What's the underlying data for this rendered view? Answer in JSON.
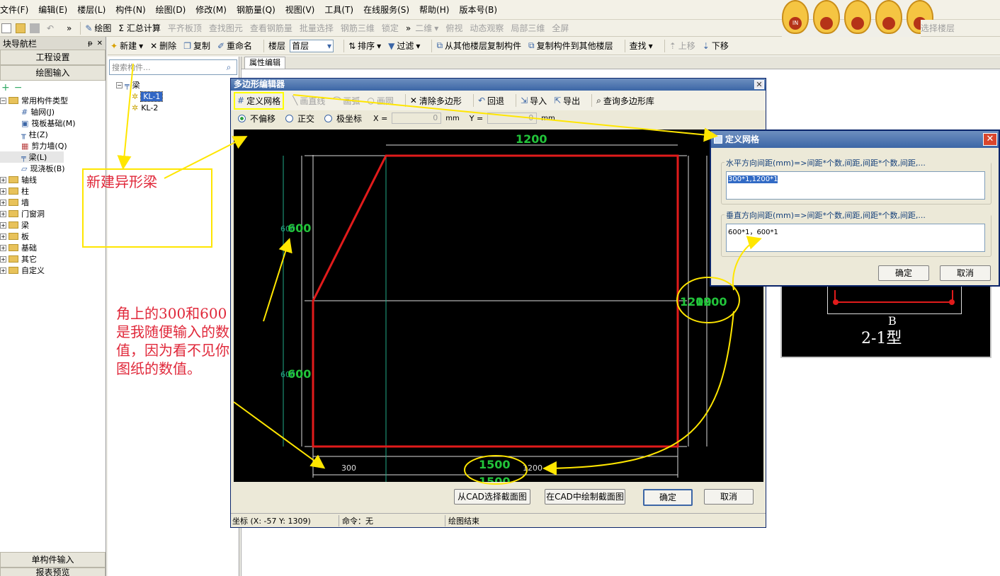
{
  "menu": [
    "文件(F)",
    "编辑(E)",
    "楼层(L)",
    "构件(N)",
    "绘图(D)",
    "修改(M)",
    "钢筋量(Q)",
    "视图(V)",
    "工具(T)",
    "在线服务(S)",
    "帮助(H)",
    "版本号(B)"
  ],
  "toolbar1": {
    "draw": "绘图",
    "sum": "Σ 汇总计算",
    "align": "平齐板顶",
    "find_elem": "查找图元",
    "view_rebar": "查看钢筋量",
    "batch": "批量选择",
    "rebar3d": "钢筋三维",
    "lock": "锁定",
    "view2d": "二维",
    "top": "俯视",
    "dyn": "动态观察",
    "local3d": "局部三维",
    "fullscreen": "全屏",
    "select_floor": "选择楼层"
  },
  "toolbar2": {
    "new": "新建",
    "delete": "删除",
    "copy": "复制",
    "rename": "重命名",
    "floor_label": "楼层",
    "floor_value": "首层",
    "sort": "排序",
    "filter": "过滤",
    "copy_from": "从其他楼层复制构件",
    "copy_to": "复制构件到其他楼层",
    "search": "查找",
    "up": "上移",
    "down": "下移"
  },
  "nav": {
    "title": "块导航栏",
    "settings": "工程设置",
    "draw_input": "绘图输入",
    "single_input": "单构件输入",
    "report": "报表预览",
    "common": "常用构件类型",
    "common_items": [
      "轴网(J)",
      "筏板基础(M)",
      "柱(Z)",
      "剪力墙(Q)",
      "梁(L)",
      "现浇板(B)"
    ],
    "folders": [
      "轴线",
      "柱",
      "墙",
      "门窗洞",
      "梁",
      "板",
      "基础",
      "其它",
      "自定义"
    ]
  },
  "component": {
    "search_placeholder": "搜索构件...",
    "root": "梁",
    "items": [
      "KL-1",
      "KL-2"
    ]
  },
  "prop_tab": "属性编辑",
  "poly": {
    "title": "多边形编辑器",
    "define_grid": "定义网格",
    "line": "画直线",
    "arc": "画弧",
    "circle": "画圆",
    "clear": "清除多边形",
    "undo": "回退",
    "import": "导入",
    "export": "导出",
    "query": "查询多边形库",
    "no_offset": "不偏移",
    "ortho": "正交",
    "polar": "极坐标",
    "x_label": "X =",
    "x_val": "0",
    "y_label": "Y =",
    "y_val": "0",
    "mm": "mm",
    "dims": {
      "top": "1200",
      "left_top": "600",
      "left_top_ghost": "600",
      "left_bottom": "600",
      "left_bottom_ghost": "600",
      "right": "1200",
      "right_ghost": "1200",
      "bottom_300": "300",
      "bottom_1200": "1200",
      "bottom_total": "1500",
      "bottom_total2": "1500"
    },
    "btn_cad_select": "从CAD选择截面图",
    "btn_cad_draw": "在CAD中绘制截面图",
    "ok": "确定",
    "cancel": "取消",
    "status_coord": "坐标 (X: -57 Y: 1309)",
    "status_cmd": "命令：无",
    "status_msg": "绘图结束"
  },
  "grid": {
    "title": "定义网格",
    "h_label": "水平方向间距(mm)=>间距*个数,间距,间距*个数,间距,...",
    "h_value": "300*1,1200*1",
    "v_label": "垂直方向间距(mm)=>间距*个数,间距,间距*个数,间距,...",
    "v_value": "600*1，600*1",
    "ok": "确定",
    "cancel": "取消"
  },
  "preview": {
    "letter": "B",
    "type": "2-1型"
  },
  "annotations": {
    "new_beam": "新建异形梁",
    "note": "角上的300和600\n是我随便输入的数\n值，因为看不见你\n图纸的数值。"
  },
  "colors": {
    "accent": "#3c66a6",
    "highlight": "#ffff00",
    "annotation": "#e0283a",
    "shape": "#e11b1b",
    "dim": "#22c43a"
  }
}
